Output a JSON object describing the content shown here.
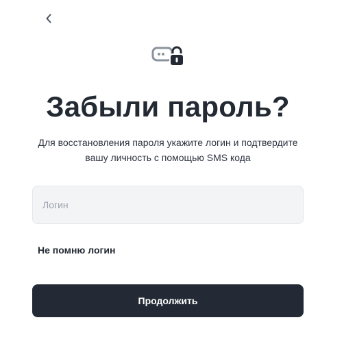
{
  "header": {
    "back_icon": "chevron-left-icon"
  },
  "logo": {
    "icon": "chat-lock-icon",
    "colors": {
      "bubble": "#8a939d",
      "lock": "#232a33"
    }
  },
  "title": "Забыли пароль?",
  "subtitle": "Для восстановления пароля укажите логин и подтвердите вашу личность с помощью SMS кода",
  "form": {
    "login_value": "",
    "login_placeholder": "Логин",
    "forgot_login_label": "Не помню логин",
    "continue_label": "Продолжить"
  },
  "colors": {
    "primary_button": "#232a35",
    "input_background": "#f3f4f6",
    "text": "#232a33"
  }
}
